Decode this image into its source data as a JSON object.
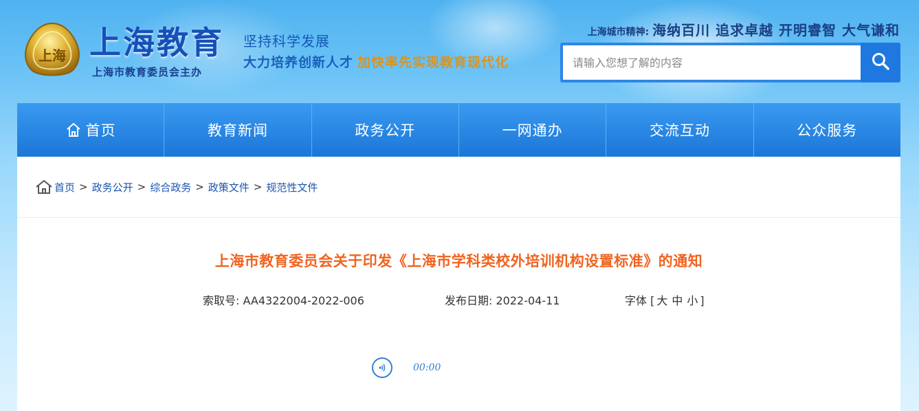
{
  "header": {
    "site_title": "上海教育",
    "site_sub": "上海市教育委员会主办",
    "slogan_line1": "坚持科学发展",
    "slogan_line2a": "大力培养创新人才",
    "slogan_line2b": "加快率先实现教育现代化",
    "spirit_label": "上海城市精神:",
    "spirit_value": "海纳百川 追求卓越 开明睿智 大气谦和",
    "emblem_text": "上海"
  },
  "search": {
    "placeholder": "请输入您想了解的内容",
    "button_icon": "search-icon"
  },
  "nav": {
    "items": [
      {
        "label": "首页",
        "icon": "home-icon"
      },
      {
        "label": "教育新闻"
      },
      {
        "label": "政务公开"
      },
      {
        "label": "一网通办"
      },
      {
        "label": "交流互动"
      },
      {
        "label": "公众服务"
      }
    ]
  },
  "breadcrumb": {
    "icon": "home-icon",
    "separator": ">",
    "items": [
      "首页",
      "政务公开",
      "综合政务",
      "政策文件",
      "规范性文件"
    ]
  },
  "article": {
    "title": "上海市教育委员会关于印发《上海市学科类校外培训机构设置标准》的通知",
    "index_label": "索取号:",
    "index_value": "AA4322004-2022-006",
    "date_label": "发布日期:",
    "date_value": "2022-04-11",
    "font_label": "字体",
    "font_open": "[",
    "font_close": "]",
    "font_sizes": [
      "大",
      "中",
      "小"
    ]
  },
  "audio": {
    "icon": "audio-play-icon",
    "time": "00:00"
  },
  "colors": {
    "brand_blue": "#1650b8",
    "nav_blue": "#1b76d8",
    "title_orange": "#f0631f",
    "slogan_gold": "#d99420"
  }
}
